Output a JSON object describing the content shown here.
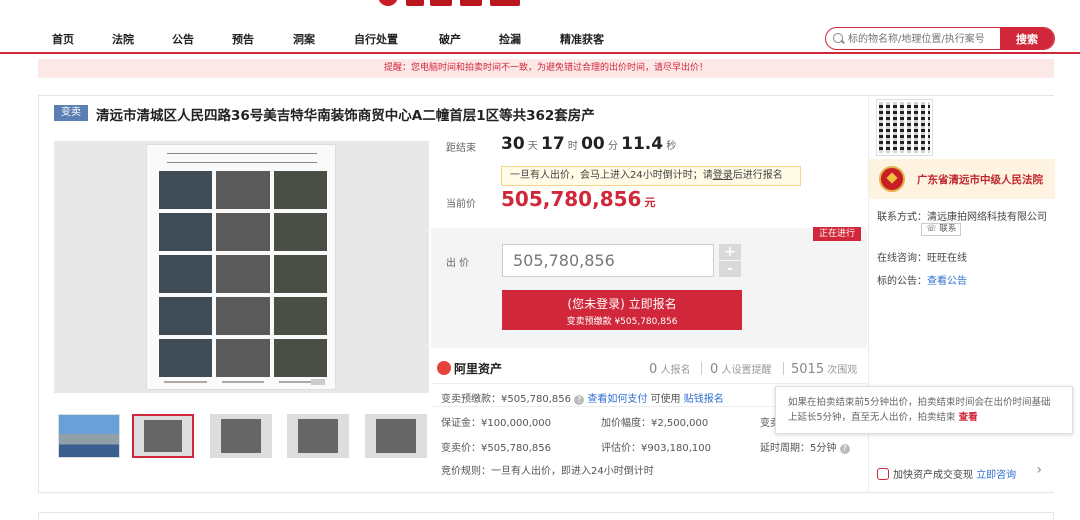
{
  "nav": {
    "items": [
      "首页",
      "法院",
      "公告",
      "预告",
      "洞案",
      "自行处置",
      "破产",
      "捡漏",
      "精准获客"
    ],
    "search_placeholder": "标的物名称/地理位置/执行案号",
    "search_button": "搜索"
  },
  "notice": "提醒：您电脑时间和拍卖时间不一致，为避免错过合理的出价时间，请尽早出价！",
  "item": {
    "tag": "变卖",
    "title": "清远市清城区人民四路36号美吉特华南装饰商贸中心A二幢首层1区等共362套房产"
  },
  "countdown": {
    "label": "距结束",
    "days": "30",
    "days_unit": "天",
    "hours": "17",
    "hours_unit": "时",
    "minutes": "00",
    "minutes_unit": "分",
    "seconds": "11.4",
    "seconds_unit": "秒"
  },
  "tip": "一旦有人出价，会马上进入24小时倒计时；请",
  "tip_link": "登录",
  "tip_tail": "后进行报名",
  "current_price": {
    "label": "当前价",
    "value": "505,780,856",
    "unit": "元"
  },
  "bid": {
    "status": "正在进行",
    "label": "出 价",
    "input_value": "505,780,856",
    "plus": "+",
    "minus": "-",
    "button_line1": "(您未登录) 立即报名",
    "button_line2": "变卖预缴款 ¥505,780,856"
  },
  "stats": {
    "brand": "阿里资产",
    "signup_count": "0",
    "signup_label": "人报名",
    "reminder_count": "0",
    "reminder_label": "人设置提醒",
    "view_count": "5015",
    "view_label": "次围观"
  },
  "details": {
    "deposit_label": "变卖预缴款：¥505,780,856",
    "deposit_link": "查看如何支付",
    "deposit_tail": "可使用",
    "deposit_link2": "贴钱报名",
    "guarantee": "保证金：¥100,000,000",
    "increment": "加价幅度：¥2,500,000",
    "sale_price": "变卖价：¥505,780,856",
    "assessed": "评估价：¥903,180,100",
    "extend": "延时周期：5分钟",
    "col3_partial": "变卖",
    "rule": "竞价规则：一旦有人出价，即进入24小时倒计时"
  },
  "court": {
    "name": "广东省清远市中级人民法院",
    "contact": "联系方式：清远康拍网络科技有限公司",
    "contact_btn": "联系",
    "online": "在线咨询：旺旺在线",
    "notice_label": "标的公告：",
    "notice_link": "查看公告",
    "promo": "加快资产成交变现",
    "promo_link": "立即咨询",
    "chevron": "›"
  },
  "tooltip": {
    "text": "如果在拍卖结束前5分钟出价，拍卖结束时间会在出价时间基础上延长5分钟，直至无人出价，拍卖结束",
    "link": "查看"
  },
  "colors": {
    "accent": "#d0273a",
    "tag": "#5b7fb3",
    "link": "#2f6fd1"
  }
}
